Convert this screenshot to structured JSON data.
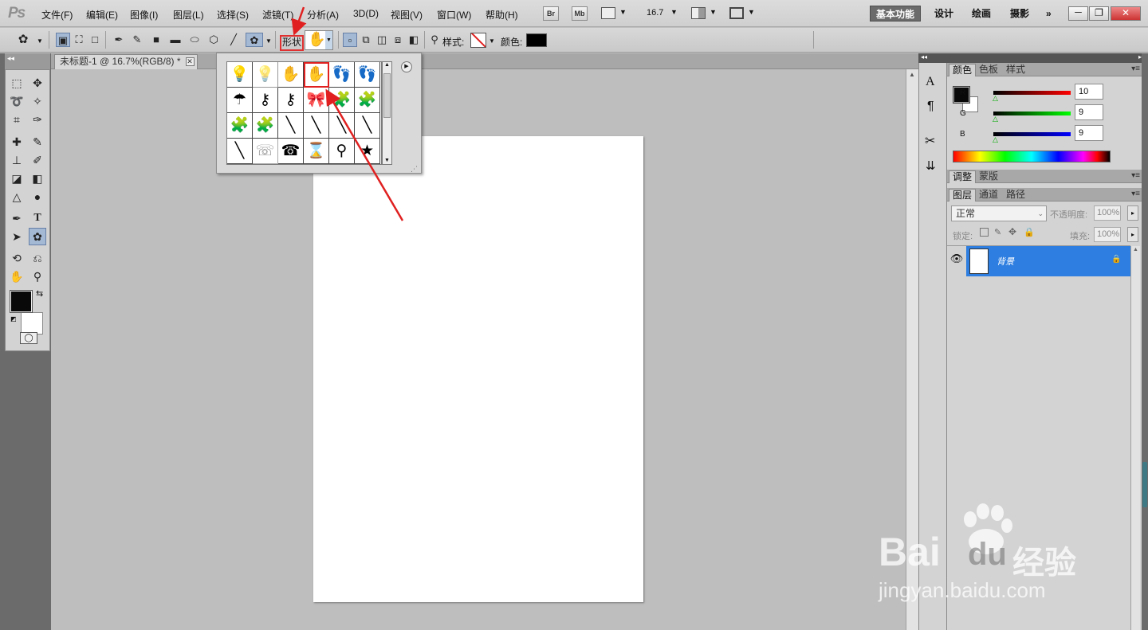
{
  "app": {
    "logo": "Ps"
  },
  "menubar": {
    "items": [
      "文件(F)",
      "编辑(E)",
      "图像(I)",
      "图层(L)",
      "选择(S)",
      "滤镜(T)",
      "分析(A)",
      "3D(D)",
      "视图(V)",
      "窗口(W)",
      "帮助(H)"
    ],
    "bridge_label": "Br",
    "minibridge_label": "Mb",
    "zoom_value": "16.7",
    "workspaces": [
      "基本功能",
      "设计",
      "绘画",
      "摄影"
    ],
    "workspace_more": "»",
    "window_buttons": [
      "－",
      "❐",
      "✕"
    ]
  },
  "options_bar": {
    "shape_label": "形状",
    "style_label": "样式:",
    "color_label": "颜色:",
    "color_value": "#000000"
  },
  "document_tab": {
    "title": "未标题-1 @ 16.7%(RGB/8) *",
    "close": "✕"
  },
  "shape_picker": {
    "flyout_icon": "▶",
    "shapes": [
      "💡",
      "💡",
      "✋",
      "✋",
      "👣",
      "👣",
      "☂",
      "⚷",
      "⚷",
      "🎀",
      "🧩",
      "🧩",
      "🧩",
      "🧩",
      "╲",
      "╲",
      "╲",
      "╲",
      "╲",
      "☏",
      "☎",
      "⌛",
      "⚲",
      "★"
    ]
  },
  "panels": {
    "color": {
      "tabs": [
        "颜色",
        "色板",
        "样式"
      ],
      "channels": [
        {
          "name": "R",
          "value": "10"
        },
        {
          "name": "G",
          "value": "9"
        },
        {
          "name": "B",
          "value": "9"
        }
      ],
      "foreground": "#0a0909",
      "background": "#ffffff"
    },
    "adjustments": {
      "tabs": [
        "调整",
        "蒙版"
      ]
    },
    "layers": {
      "tabs": [
        "图层",
        "通道",
        "路径"
      ],
      "blend_mode": "正常",
      "opacity_label": "不透明度:",
      "opacity_value": "100%",
      "lock_label": "锁定:",
      "fill_label": "填充:",
      "fill_value": "100%",
      "layer_name": "背景"
    }
  },
  "watermark": {
    "brand": "Bai",
    "brand2": "du",
    "suffix": "经验",
    "url": "jingyan.baidu.com"
  }
}
